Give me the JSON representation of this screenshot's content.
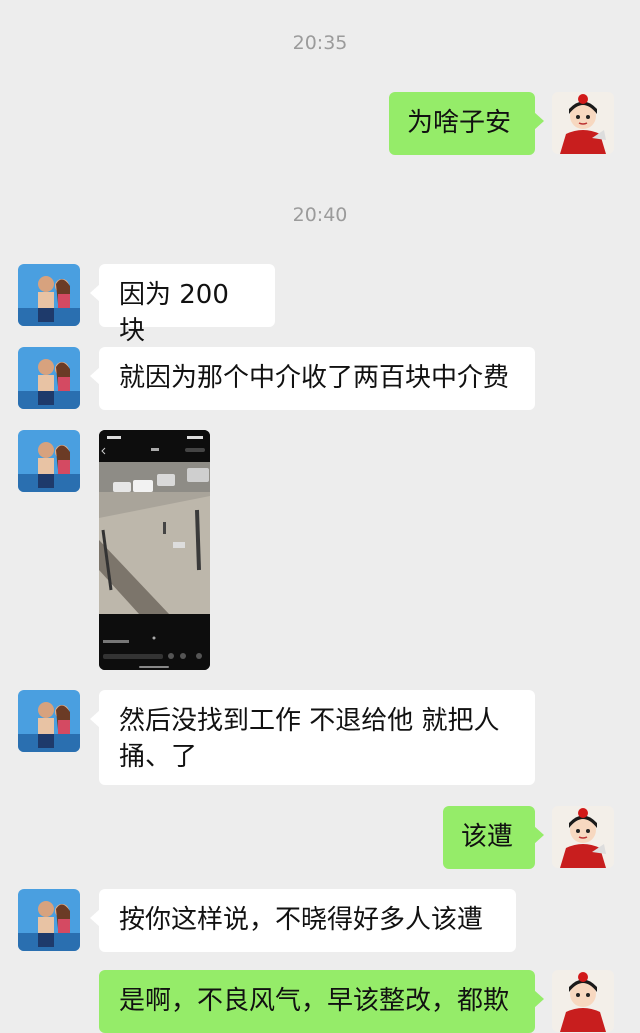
{
  "timestamps": [
    "20:35",
    "20:40"
  ],
  "messages": [
    {
      "from": "me",
      "text": "为啥子安"
    },
    {
      "from": "other",
      "text": "因为 200 块"
    },
    {
      "from": "other",
      "text": "就因为那个中介收了两百块中介费"
    },
    {
      "from": "other",
      "type": "image",
      "description": "phone screenshot of a video"
    },
    {
      "from": "other",
      "text": "然后没找到工作 不退给他 就把人捅、了"
    },
    {
      "from": "me",
      "text": "该遭"
    },
    {
      "from": "other",
      "text": "按你这样说，不晓得好多人该遭"
    },
    {
      "from": "me",
      "text": "是啊，不良风气，早该整改，都欺"
    }
  ],
  "colors": {
    "background": "#ededed",
    "my_bubble": "#95ec69",
    "their_bubble": "#ffffff",
    "timestamp": "#9b9b9b"
  }
}
